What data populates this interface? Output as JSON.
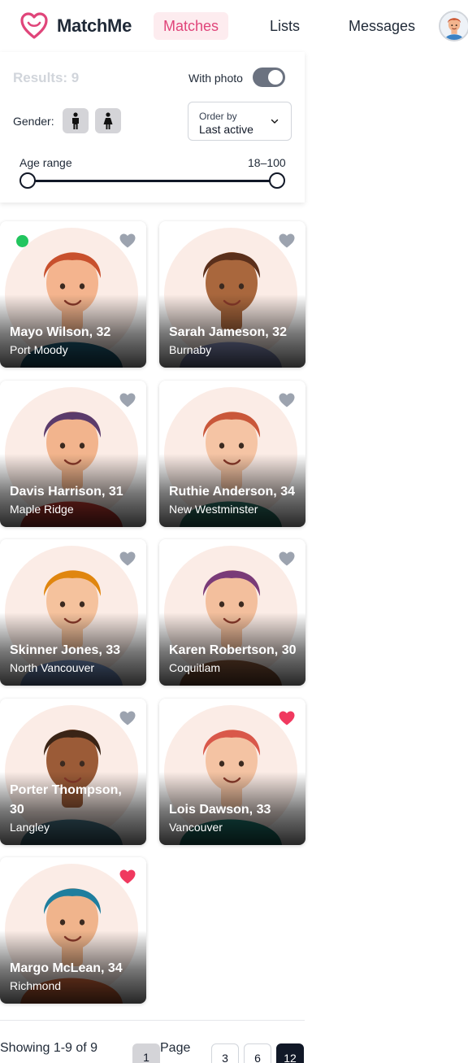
{
  "header": {
    "brand": "MatchMe",
    "nav": {
      "matches": "Matches",
      "lists": "Lists",
      "messages": "Messages"
    },
    "accent_color": "#e0457a"
  },
  "filters": {
    "results": "Results: 9",
    "with_photo_label": "With photo",
    "with_photo_on": true,
    "gender_label": "Gender:",
    "order_label": "Order by",
    "order_value": "Last active",
    "age_label": "Age range",
    "age_value": "18–100",
    "age_min": 18,
    "age_max": 100
  },
  "profiles": [
    {
      "name": "Mayo Wilson, 32",
      "city": "Port Moody",
      "online": true,
      "favorite": false,
      "hair": "#c8502d",
      "skin": "#f4b48e",
      "shirt": "#1e5f7a"
    },
    {
      "name": "Sarah Jameson, 32",
      "city": "Burnaby",
      "online": false,
      "favorite": false,
      "hair": "#5a2f1b",
      "skin": "#a9673d",
      "shirt": "#8a93c2"
    },
    {
      "name": "Davis Harrison, 31",
      "city": "Maple Ridge",
      "online": false,
      "favorite": false,
      "hair": "#5b3b6b",
      "skin": "#f2b48d",
      "shirt": "#c43a31"
    },
    {
      "name": "Ruthie Anderson, 34",
      "city": "New Westminster",
      "online": false,
      "favorite": false,
      "hair": "#c9573a",
      "skin": "#f5c4a4",
      "shirt": "#2e7a6d"
    },
    {
      "name": "Skinner Jones, 33",
      "city": "North Vancouver",
      "online": false,
      "favorite": false,
      "hair": "#e0860f",
      "skin": "#f5c29d",
      "shirt": "#7e9fd6"
    },
    {
      "name": "Karen Robertson, 30",
      "city": "Coquitlam",
      "online": false,
      "favorite": false,
      "hair": "#7a3b78",
      "skin": "#f3bf9d",
      "shirt": "#8c5a3c"
    },
    {
      "name": "Porter Thompson, 30",
      "city": "Langley",
      "online": false,
      "favorite": false,
      "hair": "#3a2416",
      "skin": "#9b5b37",
      "shirt": "#4a7a8c"
    },
    {
      "name": "Lois Dawson, 33",
      "city": "Vancouver",
      "online": false,
      "favorite": true,
      "hair": "#d9584a",
      "skin": "#f4c3a3",
      "shirt": "#1e7a70"
    },
    {
      "name": "Margo McLean, 34",
      "city": "Richmond",
      "online": false,
      "favorite": true,
      "hair": "#1f7e9e",
      "skin": "#f0b48c",
      "shirt": "#d96a3c"
    }
  ],
  "heart_colors": {
    "favorite": "#f0395f",
    "default": "#9ca3af"
  },
  "pagination": {
    "showing": "Showing 1-9 of 9",
    "page_word": "Page",
    "current": "1",
    "pages": [
      "3",
      "6",
      "12"
    ]
  }
}
